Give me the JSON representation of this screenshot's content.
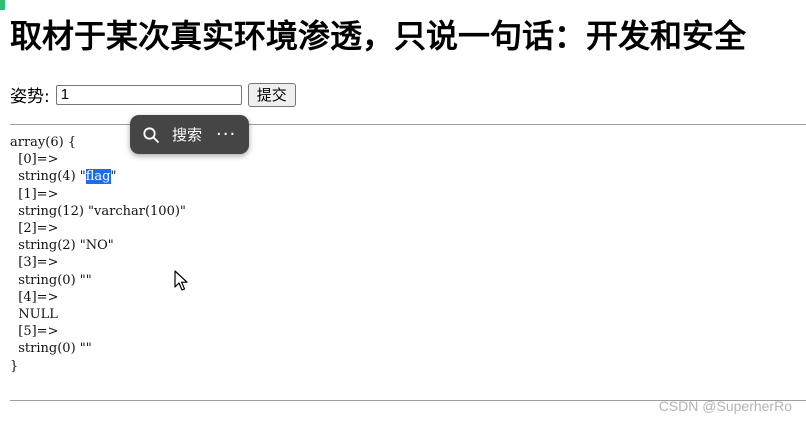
{
  "page": {
    "title": "取材于某次真实环境渗透，只说一句话：开发和安全"
  },
  "form": {
    "label": "姿势:",
    "input_value": "1",
    "submit_label": "提交"
  },
  "popup": {
    "search_label": "搜索",
    "more_label": "···",
    "search_icon": "search-icon"
  },
  "output": {
    "lines": [
      {
        "pre": "array(6) {",
        "sel": "",
        "post": ""
      },
      {
        "pre": "  [0]=>",
        "sel": "",
        "post": ""
      },
      {
        "pre": "  string(4) \"",
        "sel": "flag",
        "post": "\""
      },
      {
        "pre": "  [1]=>",
        "sel": "",
        "post": ""
      },
      {
        "pre": "  string(12) \"varchar(100)\"",
        "sel": "",
        "post": ""
      },
      {
        "pre": "  [2]=>",
        "sel": "",
        "post": ""
      },
      {
        "pre": "  string(2) \"NO\"",
        "sel": "",
        "post": ""
      },
      {
        "pre": "  [3]=>",
        "sel": "",
        "post": ""
      },
      {
        "pre": "  string(0) \"\"",
        "sel": "",
        "post": ""
      },
      {
        "pre": "  [4]=>",
        "sel": "",
        "post": ""
      },
      {
        "pre": "  NULL",
        "sel": "",
        "post": ""
      },
      {
        "pre": "  [5]=>",
        "sel": "",
        "post": ""
      },
      {
        "pre": "  string(0) \"\"",
        "sel": "",
        "post": ""
      },
      {
        "pre": "}",
        "sel": "",
        "post": ""
      }
    ]
  },
  "watermark": "CSDN @SuperherRo",
  "colors": {
    "selection": "#1a6fe6",
    "popup_bg": "#454545",
    "accent": "#2fbf71"
  }
}
